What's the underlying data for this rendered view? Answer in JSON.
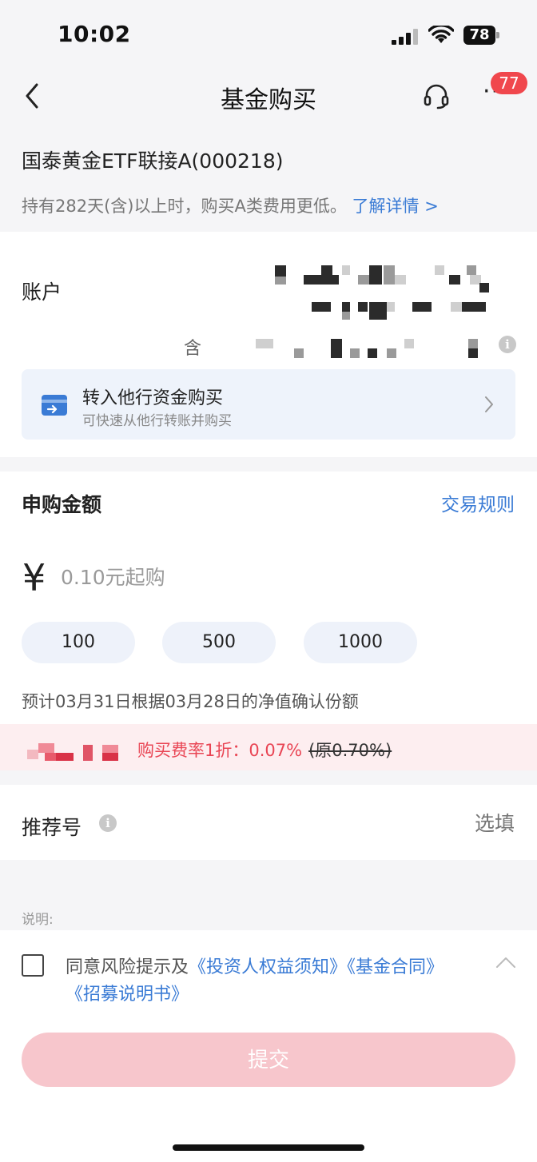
{
  "status_bar": {
    "time": "10:02",
    "battery": "78"
  },
  "nav": {
    "title": "基金购买",
    "badge_count": "77",
    "more_label": "···"
  },
  "fund": {
    "name": "国泰黄金ETF联接A(000218)",
    "tip": "持有282天(含)以上时，购买A类费用更低。",
    "tip_link": "了解详情 >"
  },
  "account": {
    "label": "账户",
    "hint_prefix": "含",
    "info_glyph": "i"
  },
  "transfer": {
    "title": "转入他行资金购买",
    "subtitle": "可快速从他行转账并购买"
  },
  "purchase": {
    "title": "申购金额",
    "rules_link": "交易规则",
    "currency": "¥",
    "amount_placeholder": "0.10元起购",
    "chips": [
      "100",
      "500",
      "1000"
    ],
    "confirm_note": "预计03月31日根据03月28日的净值确认份额"
  },
  "fee": {
    "text": "购买费率1折：0.07%",
    "original": "(原0.70%)"
  },
  "referral": {
    "label": "推荐号",
    "hint": "选填",
    "info_glyph": "i"
  },
  "agreement": {
    "explain_label": "说明:",
    "prefix": "同意风险提示及",
    "doc1": "《投资人权益须知》",
    "doc2": "《基金合同》",
    "doc3": "《招募说明书》"
  },
  "submit": {
    "label": "提交"
  },
  "colors": {
    "accent_blue": "#3a7bd5",
    "fee_red": "#e94554",
    "badge_red": "#f0474d",
    "submit_disabled": "#f7c6cc"
  }
}
